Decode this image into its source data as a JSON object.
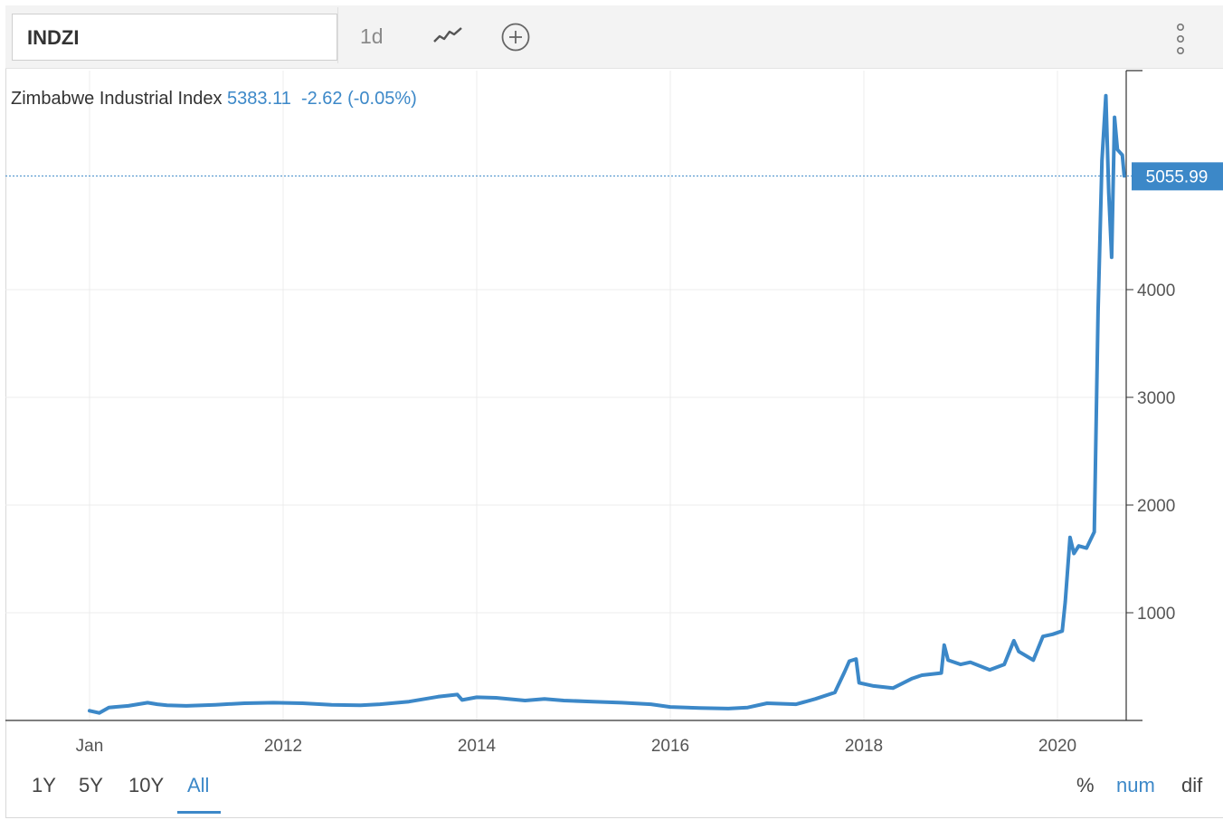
{
  "toolbar": {
    "symbol": "INDZI",
    "interval": "1d",
    "icons": [
      "line-chart-icon",
      "add-circle-icon",
      "kebab-menu-icon"
    ]
  },
  "header": {
    "name": "Zimbabwe Industrial Index",
    "value": "5383.11",
    "change": "-2.62 (-0.05%)"
  },
  "price_tag": "5055.99",
  "ranges": {
    "r1y": "1Y",
    "r5y": "5Y",
    "r10y": "10Y",
    "rall": "All",
    "active": "All"
  },
  "modes": {
    "pct": "%",
    "num": "num",
    "dif": "dif",
    "active": "num"
  },
  "colors": {
    "line": "#3c88c8",
    "tag_bg": "#3c88c8",
    "grid": "#ececec"
  },
  "chart_data": {
    "type": "line",
    "title": "Zimbabwe Industrial Index",
    "x_tick_labels": [
      "Jan",
      "2012",
      "2014",
      "2016",
      "2018",
      "2020"
    ],
    "y_tick_labels": [
      "1000",
      "2000",
      "3000",
      "4000"
    ],
    "ylim": [
      0,
      6000
    ],
    "xlim": [
      2009.87,
      2020.7
    ],
    "last_value": 5055.99,
    "grid": true,
    "series": [
      {
        "values": [
          [
            2010.0,
            90
          ],
          [
            2010.1,
            70
          ],
          [
            2010.2,
            120
          ],
          [
            2010.4,
            135
          ],
          [
            2010.6,
            165
          ],
          [
            2010.7,
            150
          ],
          [
            2010.8,
            140
          ],
          [
            2011.0,
            135
          ],
          [
            2011.3,
            145
          ],
          [
            2011.6,
            160
          ],
          [
            2011.9,
            165
          ],
          [
            2012.2,
            160
          ],
          [
            2012.5,
            145
          ],
          [
            2012.8,
            140
          ],
          [
            2013.0,
            150
          ],
          [
            2013.3,
            175
          ],
          [
            2013.6,
            220
          ],
          [
            2013.8,
            240
          ],
          [
            2013.85,
            190
          ],
          [
            2014.0,
            215
          ],
          [
            2014.2,
            210
          ],
          [
            2014.5,
            185
          ],
          [
            2014.7,
            200
          ],
          [
            2014.9,
            185
          ],
          [
            2015.2,
            175
          ],
          [
            2015.5,
            165
          ],
          [
            2015.8,
            150
          ],
          [
            2016.0,
            125
          ],
          [
            2016.3,
            115
          ],
          [
            2016.6,
            110
          ],
          [
            2016.8,
            120
          ],
          [
            2017.0,
            160
          ],
          [
            2017.3,
            150
          ],
          [
            2017.5,
            200
          ],
          [
            2017.7,
            260
          ],
          [
            2017.8,
            450
          ],
          [
            2017.85,
            550
          ],
          [
            2017.92,
            570
          ],
          [
            2017.95,
            350
          ],
          [
            2018.1,
            320
          ],
          [
            2018.3,
            300
          ],
          [
            2018.5,
            390
          ],
          [
            2018.6,
            420
          ],
          [
            2018.8,
            440
          ],
          [
            2018.83,
            700
          ],
          [
            2018.87,
            560
          ],
          [
            2019.0,
            520
          ],
          [
            2019.1,
            540
          ],
          [
            2019.3,
            470
          ],
          [
            2019.45,
            520
          ],
          [
            2019.55,
            740
          ],
          [
            2019.6,
            640
          ],
          [
            2019.75,
            560
          ],
          [
            2019.85,
            780
          ],
          [
            2019.95,
            800
          ],
          [
            2020.05,
            830
          ],
          [
            2020.08,
            1100
          ],
          [
            2020.13,
            1700
          ],
          [
            2020.17,
            1550
          ],
          [
            2020.22,
            1620
          ],
          [
            2020.3,
            1600
          ],
          [
            2020.38,
            1750
          ],
          [
            2020.42,
            3800
          ],
          [
            2020.46,
            5200
          ],
          [
            2020.5,
            5800
          ],
          [
            2020.53,
            4900
          ],
          [
            2020.56,
            4300
          ],
          [
            2020.59,
            5600
          ],
          [
            2020.62,
            5300
          ],
          [
            2020.67,
            5250
          ],
          [
            2020.69,
            5055.99
          ]
        ]
      }
    ]
  }
}
